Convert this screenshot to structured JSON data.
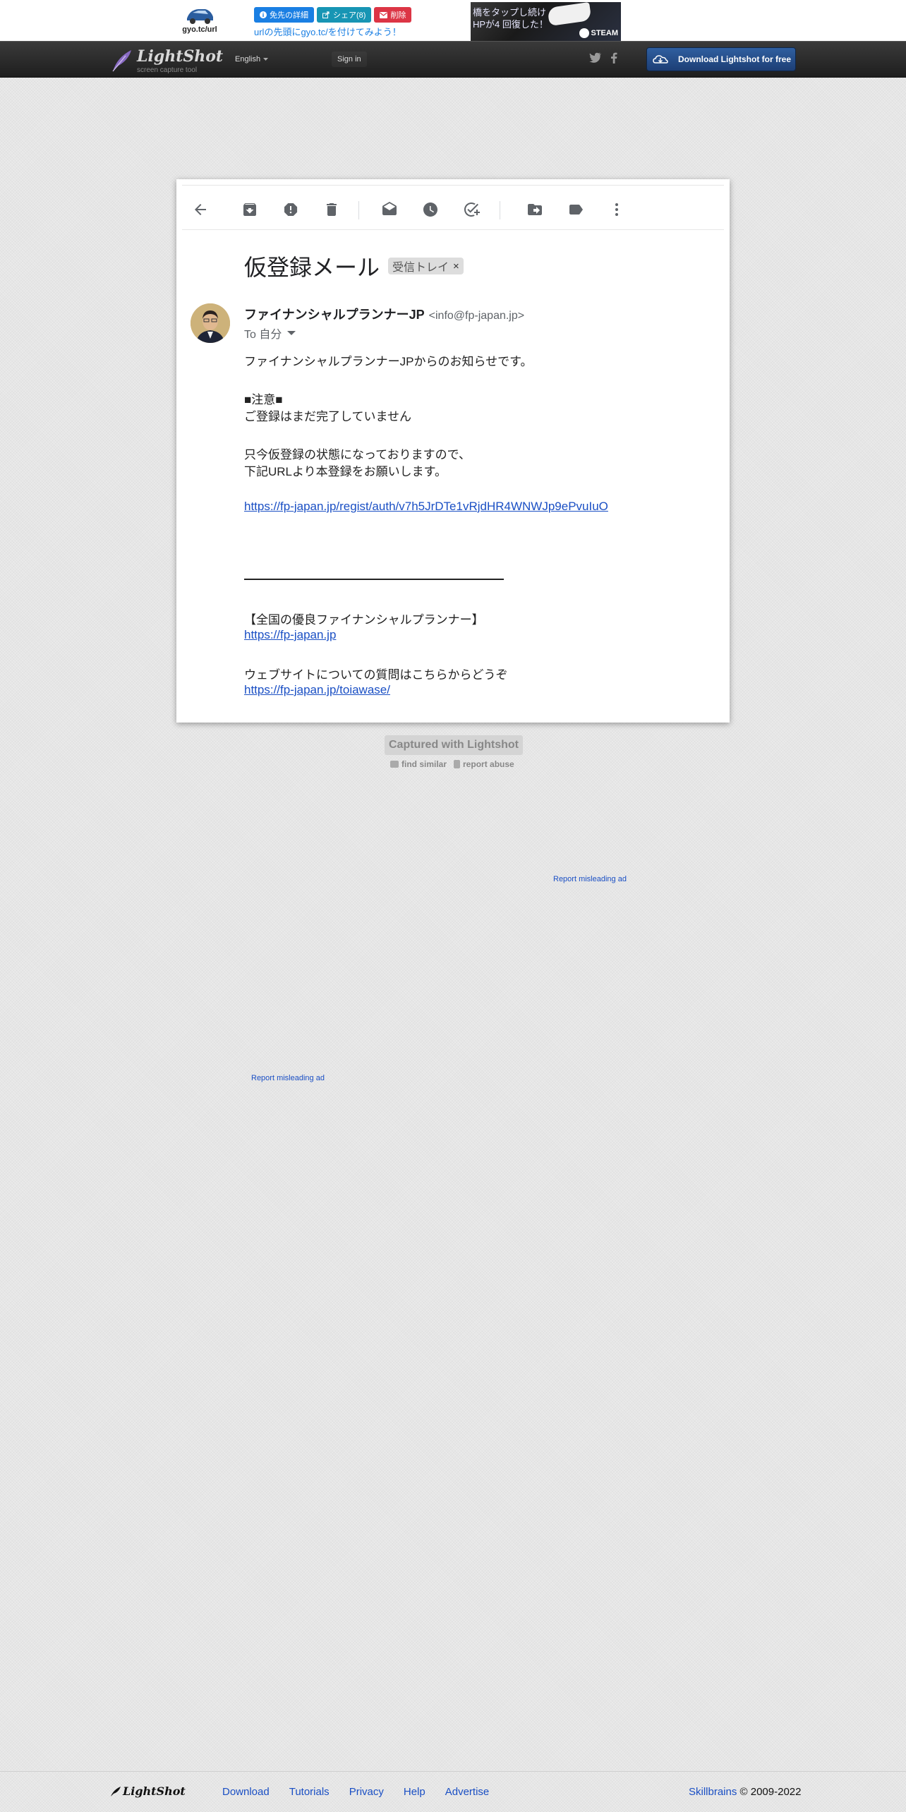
{
  "top_ad": {
    "logo_text": "gyo.tc/url",
    "buttons": [
      {
        "label": "免先の詳細",
        "icon": "info-icon"
      },
      {
        "label": "シェア(8)",
        "icon": "share-icon"
      },
      {
        "label": "削除",
        "icon": "mail-icon"
      }
    ],
    "link_text": "urlの先頭にgyo.tc/を付けてみよう！",
    "steam_ad": {
      "line1": "橋をタップし続け",
      "line2": "HPが4 回復した！",
      "brand": "STEAM"
    }
  },
  "header": {
    "brand_name": "LightShot",
    "brand_tagline": "screen capture tool",
    "language": "English",
    "sign_in": "Sign in",
    "download_label": "Download Lightshot for free"
  },
  "email": {
    "subject": "仮登録メール",
    "label_chip": "受信トレイ",
    "chip_close": "×",
    "sender_name": "ファイナンシャルプランナーJP",
    "sender_email": "<info@fp-japan.jp>",
    "to_line": "To 自分",
    "body": {
      "intro": "ファイナンシャルプランナーJPからのお知らせです。",
      "notice_heading": "■注意■",
      "notice_text": "ご登録はまだ完了していません",
      "line_a": "只今仮登録の状態になっておりますので、",
      "line_b": "下記URLより本登録をお願いします。",
      "reg_url": "https://fp-japan.jp/regist/auth/v7h5JrDTe1vRjdHR4WNWJp9ePvuIuO",
      "sig_title": "【全国の優良ファイナンシャルプランナー】",
      "site_url": "https://fp-japan.jp",
      "contact_text": "ウェブサイトについての質問はこちらからどうぞ",
      "contact_url": "https://fp-japan.jp/toiawase/"
    }
  },
  "capture": {
    "badge": "Captured with Lightshot",
    "find_similar": "find similar",
    "report_abuse": "report abuse"
  },
  "ads": {
    "report_1": "Report misleading ad",
    "report_2": "Report misleading ad"
  },
  "footer": {
    "brand": "LightShot",
    "nav": [
      "Download",
      "Tutorials",
      "Privacy",
      "Help",
      "Advertise"
    ],
    "company": "Skillbrains",
    "copyright": "© 2009-2022"
  },
  "colors": {
    "link": "#1a4fc4",
    "download_button": "#2f5fa0",
    "ad_blue": "#1a7fe3",
    "ad_red": "#dc3545"
  }
}
